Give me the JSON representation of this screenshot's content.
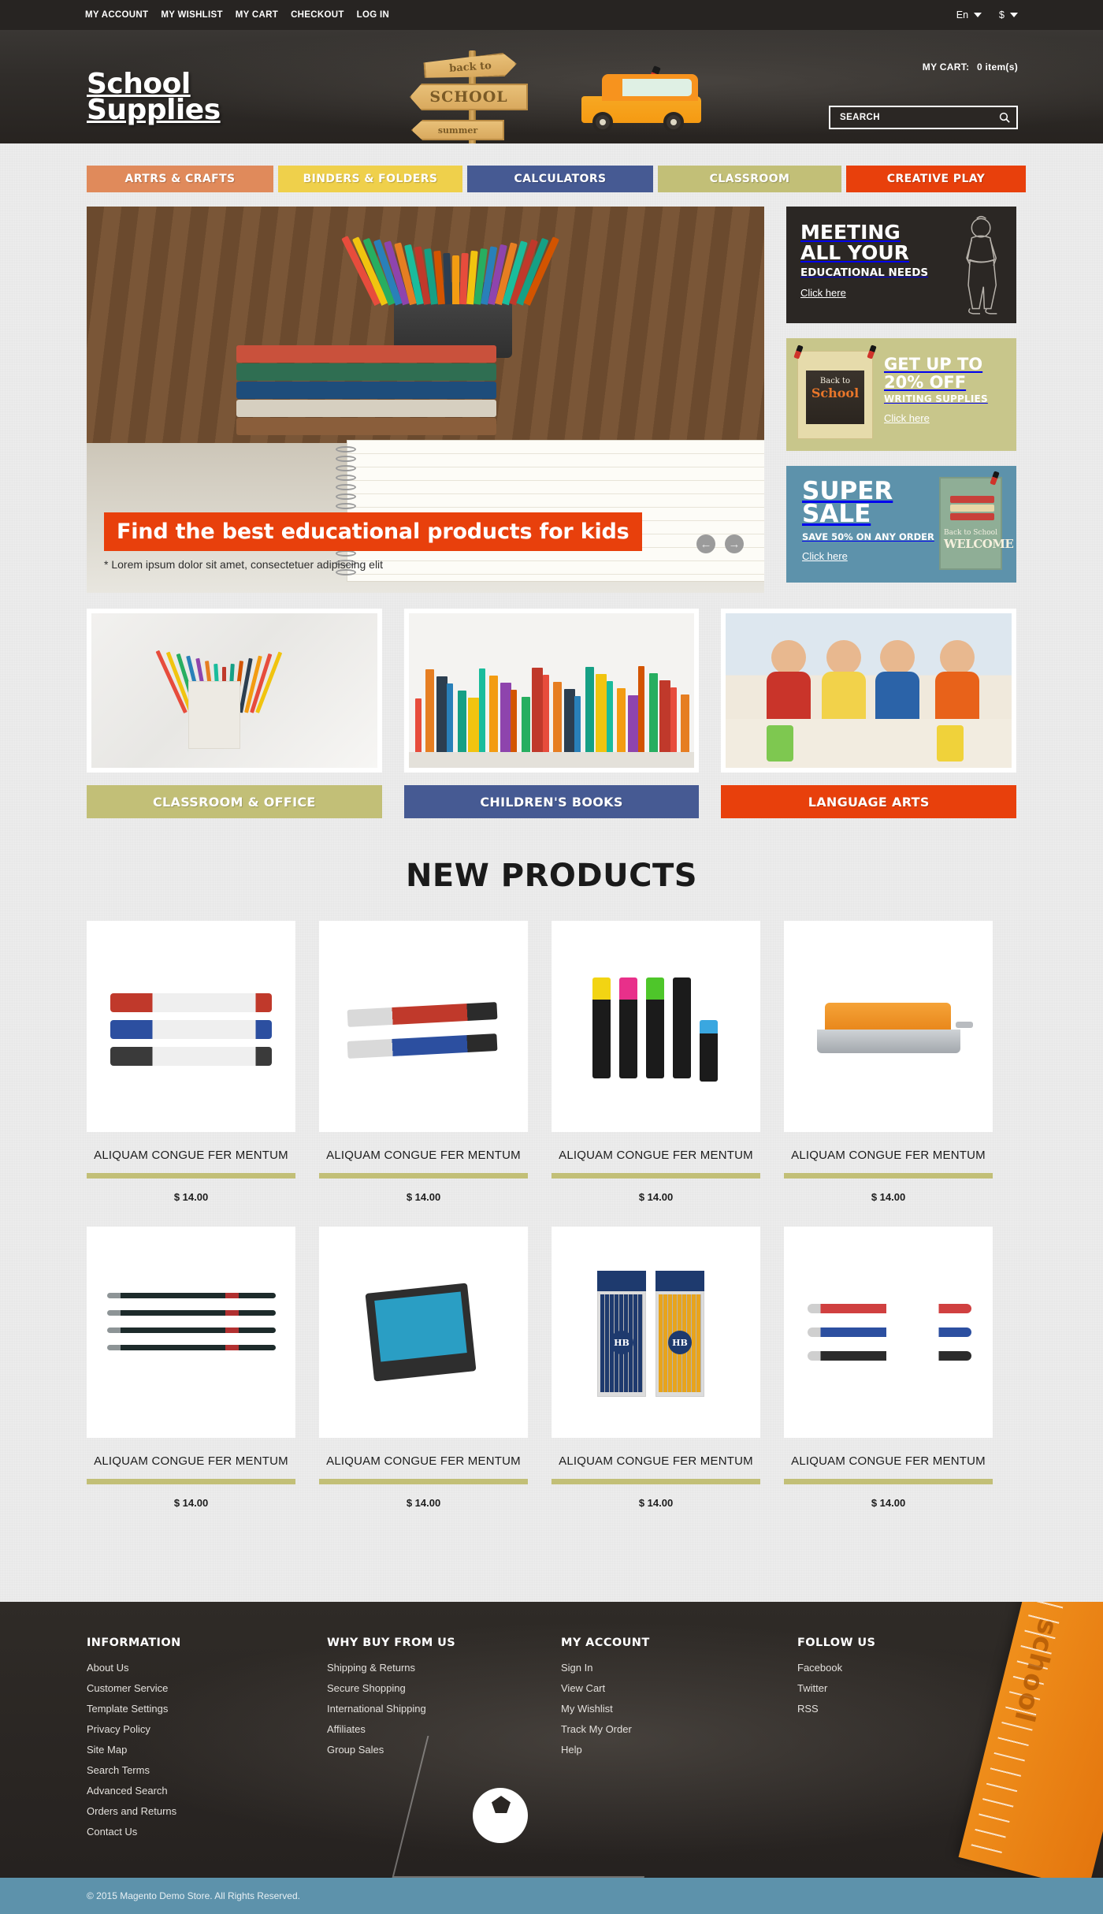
{
  "topbar": {
    "links": [
      {
        "label": "MY ACCOUNT",
        "name": "my-account"
      },
      {
        "label": "MY WISHLIST",
        "name": "my-wishlist"
      },
      {
        "label": "MY CART",
        "name": "my-cart"
      },
      {
        "label": "CHECKOUT",
        "name": "checkout"
      },
      {
        "label": "LOG IN",
        "name": "log-in"
      }
    ],
    "language": "En",
    "currency": "$"
  },
  "header": {
    "logo_line1": "School",
    "logo_line2": "Supplies",
    "sign_top": "back to",
    "sign_mid": "SCHOOL",
    "sign_bottom": "summer",
    "cart_label": "MY CART:",
    "cart_qty": "0 item(s)",
    "search_placeholder": "SEARCH",
    "search_value": ""
  },
  "nav": [
    {
      "label": "ARTRS & CRAFTS",
      "color": "#e08a5b"
    },
    {
      "label": "BINDERS & FOLDERS",
      "color": "#efd04b"
    },
    {
      "label": "CALCULATORS",
      "color": "#465a93"
    },
    {
      "label": "CLASSROOM",
      "color": "#c2bf77"
    },
    {
      "label": "CREATIVE PLAY",
      "color": "#e8400c"
    }
  ],
  "slider": {
    "title": "Find the best educational products for kids",
    "subtitle": "* Lorem ipsum dolor sit amet, consectetuer adipiscing elit",
    "prev": "←",
    "next": "→"
  },
  "banners": {
    "meeting": {
      "line1": "MEETING",
      "line2": "ALL YOUR",
      "line3": "EDUCATIONAL NEEDS",
      "cta": "Click here"
    },
    "offer": {
      "line1": "GET UP TO",
      "line2": "20% OFF",
      "line3": "WRITING SUPPLIES",
      "cta": "Click here",
      "note_line1": "Back to",
      "note_line2": "School"
    },
    "sale": {
      "line1": "SUPER",
      "line2": "SALE",
      "line3": "SAVE 50% ON ANY ORDER",
      "cta": "Click here",
      "card_line1": "Back to School",
      "card_line2": "WELCOME"
    }
  },
  "categories": [
    {
      "label": "CLASSROOM & OFFICE",
      "color": "#c2bf77"
    },
    {
      "label": "CHILDREN'S BOOKS",
      "color": "#465a93"
    },
    {
      "label": "LANGUAGE ARTS",
      "color": "#e8400c"
    }
  ],
  "new_products": {
    "title": "NEW PRODUCTS",
    "items": [
      {
        "name": "ALIQUAM CONGUE FER MENTUM",
        "price": "$ 14.00",
        "image": "permanent-markers"
      },
      {
        "name": "ALIQUAM CONGUE FER MENTUM",
        "price": "$ 14.00",
        "image": "utility-knives"
      },
      {
        "name": "ALIQUAM CONGUE FER MENTUM",
        "price": "$ 14.00",
        "image": "highlighters"
      },
      {
        "name": "ALIQUAM CONGUE FER MENTUM",
        "price": "$ 14.00",
        "image": "hole-punch"
      },
      {
        "name": "ALIQUAM CONGUE FER MENTUM",
        "price": "$ 14.00",
        "image": "black-pens"
      },
      {
        "name": "ALIQUAM CONGUE FER MENTUM",
        "price": "$ 14.00",
        "image": "calculator"
      },
      {
        "name": "ALIQUAM CONGUE FER MENTUM",
        "price": "$ 14.00",
        "image": "pencil-packs"
      },
      {
        "name": "ALIQUAM CONGUE FER MENTUM",
        "price": "$ 14.00",
        "image": "gel-pens"
      }
    ]
  },
  "footer": {
    "columns": [
      {
        "title": "INFORMATION",
        "links": [
          "About Us",
          "Customer Service",
          "Template Settings",
          "Privacy Policy",
          "Site Map",
          "Search Terms",
          "Advanced Search",
          "Orders and Returns",
          "Contact Us"
        ]
      },
      {
        "title": "WHY BUY FROM US",
        "links": [
          "Shipping & Returns",
          "Secure Shopping",
          "International Shipping",
          "Affiliates",
          "Group Sales"
        ]
      },
      {
        "title": "MY ACCOUNT",
        "links": [
          "Sign In",
          "View Cart",
          "My Wishlist",
          "Track My Order",
          "Help"
        ]
      },
      {
        "title": "FOLLOW US",
        "links": [
          "Facebook",
          "Twitter",
          "RSS"
        ]
      }
    ],
    "ruler_word": "school",
    "copyright": "© 2015 Magento Demo Store. All Rights Reserved."
  }
}
